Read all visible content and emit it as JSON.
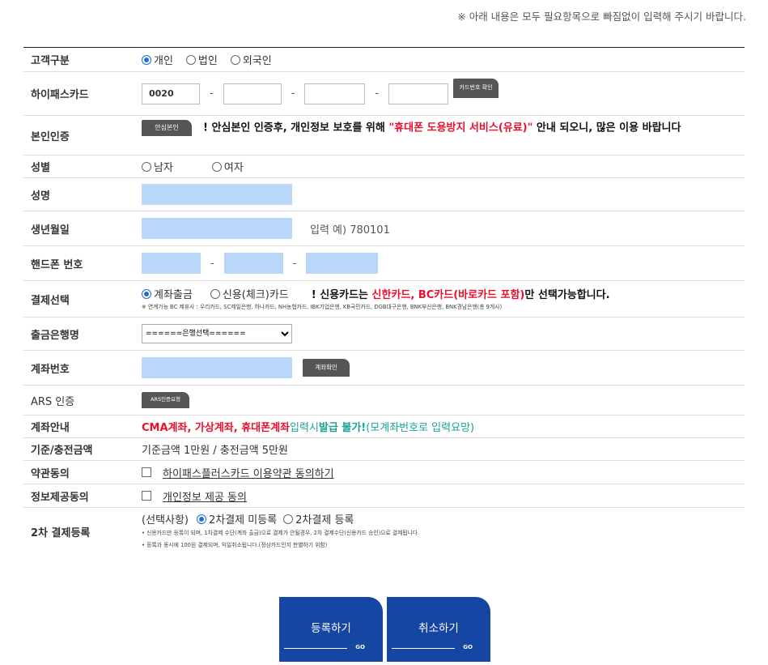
{
  "notice": "※ 아래 내용은 모두 필요항목으로 빠짐없이 입력해 주시기 바랍니다.",
  "customer_type": {
    "label": "고객구분",
    "options": [
      "개인",
      "법인",
      "외국인"
    ],
    "selected": "개인"
  },
  "card": {
    "label": "하이패스카드",
    "part1": "0020",
    "part2": "",
    "part3": "",
    "part4": "",
    "separator": "-",
    "check_button": "카드번호 확인"
  },
  "identity": {
    "label": "본인인증",
    "button": "안심본인",
    "msg_pre": "! 안심본인 인증후, 개인정보 보호를 위해 ",
    "msg_highlight": "\"휴대폰 도용방지 서비스(유료)\"",
    "msg_post": " 안내 되오니, 많은 이용 바랍니다"
  },
  "gender": {
    "label": "성별",
    "options": [
      "남자",
      "여자"
    ]
  },
  "name": {
    "label": "성명",
    "value": ""
  },
  "birth": {
    "label": "생년월일",
    "value": "",
    "example": "입력 예) 780101"
  },
  "phone": {
    "label": "핸드폰 번호",
    "p1": "",
    "p2": "",
    "p3": "",
    "separator": "-"
  },
  "payment": {
    "label": "결제선택",
    "options": [
      "계좌출금",
      "신용(체크)카드"
    ],
    "selected": "계좌출금",
    "warn_pre": "! 신용카드는 ",
    "warn_red": "신한카드, BC카드(바로카드 포함)",
    "warn_post": "만 선택가능합니다.",
    "note": "※ 연계가능 BC 제휴사 : 우리카드, SC제일은행, 하나카드, NH농협카드, IBK기업은행, KB국민카드, DGB대구은행, BNK부산은행, BNK경남은행(총 9개사)"
  },
  "bank": {
    "label": "출금은행명",
    "selected": "======은행선택======"
  },
  "account": {
    "label": "계좌번호",
    "value": "",
    "button": "계좌확인"
  },
  "ars": {
    "label": "ARS 인증",
    "button": "ARS인증요청"
  },
  "account_notice": {
    "label": "계좌안내",
    "red": "CMA계좌, 가상계좌, 휴대폰계좌",
    "green_pre": " 입력시 ",
    "green_bold": "발급 불가!",
    "green_post": " (모계좌번호로 입력요망)"
  },
  "base_amount": {
    "label": "기준/충전금액",
    "text": "기준금액 1만원 / 충전금액 5만원"
  },
  "terms": {
    "label": "약관동의",
    "link": "하이패스플러스카드 이용약관 동의하기"
  },
  "privacy": {
    "label": "정보제공동의",
    "link": "개인정보 제공 동의"
  },
  "secondary": {
    "label": "2차 결제등록",
    "prefix": "(선택사항)",
    "options": [
      "2차결제 미등록",
      "2차결제 등록"
    ],
    "selected": "2차결제 미등록",
    "note1": "• 신용카드만 등록이 되며, 1차결제 수단(계좌 출금)으로 결제가 안될경우, 2차 결제수단(신용카드 승인)으로 결제됩니다.",
    "note2": "• 등록과 동시에 100원 결제되며, 익일취소됩니다.(정상카드인지 판별하기 위함)"
  },
  "buttons": {
    "register": "등록하기",
    "cancel": "취소하기",
    "go": "GO"
  },
  "colors": {
    "accent_blue": "#1646a3",
    "input_fill": "#b8d7f9",
    "warning_red": "#e8102b",
    "notice_green": "#1aa296",
    "radio_blue": "#1a6fd8"
  }
}
